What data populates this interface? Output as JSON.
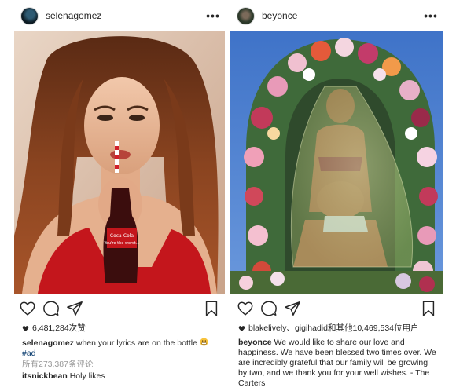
{
  "posts": [
    {
      "username": "selenagomez",
      "more_label": "•••",
      "image_alt": "Woman in red top sipping from a Coca-Cola bottle",
      "bottle_text_1": "Coca-Cola",
      "bottle_text_2": "You're the worst...",
      "likes_text": "6,481,284次赞",
      "caption_user": "selenagomez",
      "caption_text": " when your lyrics are on the bottle ",
      "hashtag": "#ad",
      "view_all": "所有273,387条评论",
      "comment_user": "itsnickbean",
      "comment_text": " Holy likes"
    },
    {
      "username": "beyonce",
      "more_label": "•••",
      "image_alt": "Woman kneeling in front of a floral arch wearing a green veil",
      "likes_text": "blakelively、gigihadid和其他10,469,534位用户",
      "caption_user": "beyonce",
      "caption_text": " We would like to share our love and happiness. We have been blessed two times over. We are incredibly grateful  that our family will be growing by two, and we thank you for your well wishes. - The Carters"
    }
  ],
  "colors": {
    "text": "#262626",
    "hashtag": "#003569",
    "muted": "#999999",
    "coke_red": "#c4161c",
    "sky": "#4a7fd0"
  },
  "icons": [
    "heart-icon",
    "comment-icon",
    "share-icon",
    "bookmark-icon",
    "more-icon"
  ]
}
